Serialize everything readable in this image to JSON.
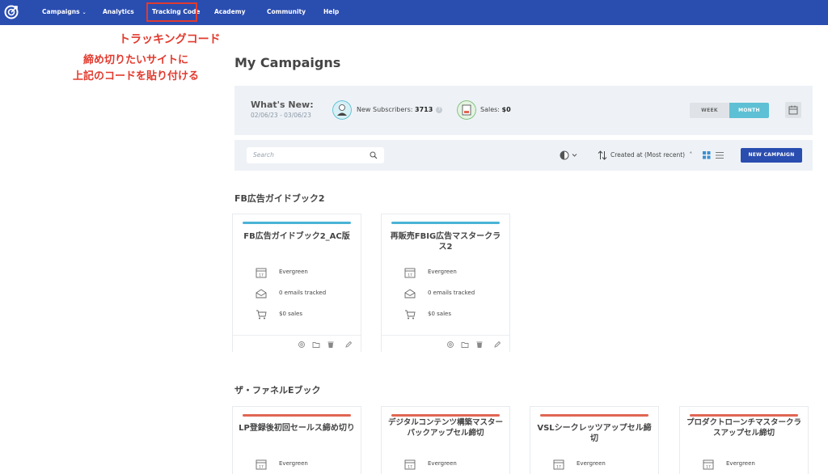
{
  "nav": {
    "items": [
      {
        "label": "Campaigns",
        "has_dropdown": true
      },
      {
        "label": "Analytics"
      },
      {
        "label": "Tracking Code"
      },
      {
        "label": "Academy"
      },
      {
        "label": "Community"
      },
      {
        "label": "Help"
      }
    ]
  },
  "annotations": {
    "tracking_code": "トラッキングコード",
    "instruction_line1": "締め切りたいサイトに",
    "instruction_line2": "上記のコードを貼り付ける",
    "color": "#e23a2e"
  },
  "page": {
    "title": "My Campaigns"
  },
  "whats_new": {
    "title": "What's New:",
    "date_range": "02/06/23 - 03/06/23",
    "subscribers_label": "New Subscribers:",
    "subscribers_value": "3713",
    "sales_label": "Sales:",
    "sales_value": "$0",
    "period_options": [
      "WEEK",
      "MONTH"
    ],
    "period_selected": "MONTH"
  },
  "toolbar": {
    "search_placeholder": "Search",
    "sort_label": "Created at (Most recent)",
    "new_campaign_label": "NEW CAMPAIGN"
  },
  "groups": [
    {
      "title": "FB広告ガイドブック2",
      "accent": "#4bb3d6",
      "campaigns": [
        {
          "title": "FB広告ガイドブック2_AC版",
          "type": "Evergreen",
          "emails": "0 emails tracked",
          "sales": "$0 sales"
        },
        {
          "title": "再販売FBIG広告マスタークラス2",
          "type": "Evergreen",
          "emails": "0 emails tracked",
          "sales": "$0 sales"
        }
      ]
    },
    {
      "title": "ザ・ファネルEブック",
      "accent": "#e06652",
      "campaigns": [
        {
          "title": "LP登録後初回セールス締め切り",
          "type": "Evergreen"
        },
        {
          "title": "デジタルコンテンツ構築マスターパックアップセル締切",
          "type": "Evergreen"
        },
        {
          "title": "VSLシークレッツアップセル締切",
          "type": "Evergreen"
        },
        {
          "title": "プロダクトローンチマスタークラスアップセル締切",
          "type": "Evergreen"
        }
      ]
    }
  ],
  "colors": {
    "nav_bg": "#2a4db0",
    "panel_bg": "#eef2f6",
    "month_active": "#5ec0d4"
  }
}
